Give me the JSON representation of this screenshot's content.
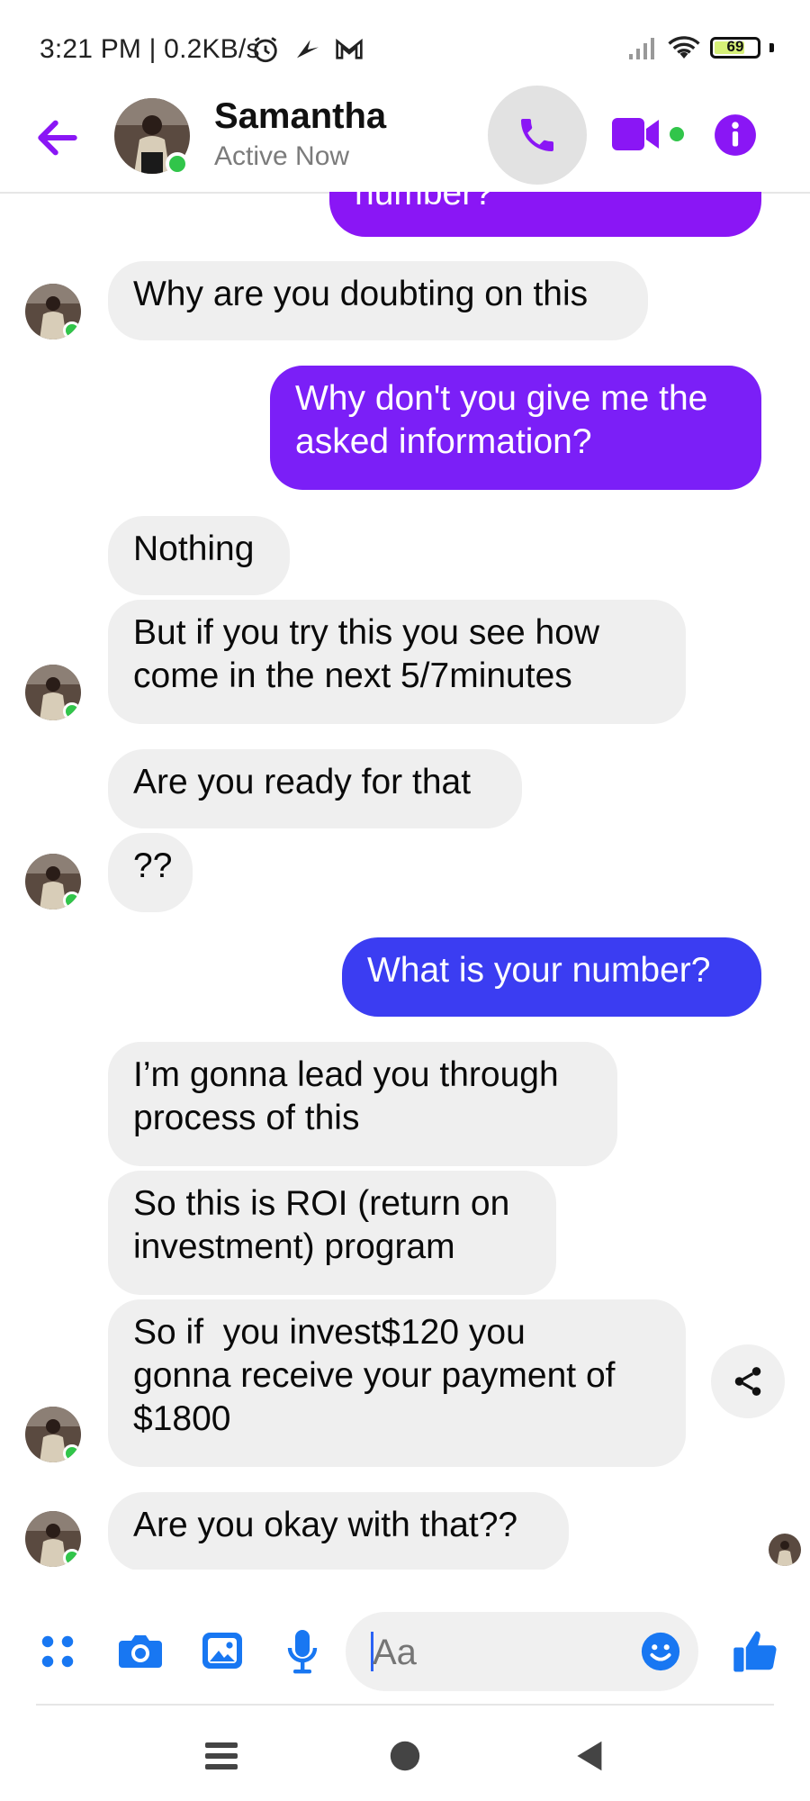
{
  "status_bar": {
    "time_speed": "3:21 PM | 0.2KB/s",
    "battery": "69",
    "battery_level": 0.69,
    "icons": [
      "alarm-icon",
      "bird-icon",
      "gmail-icon",
      "signal-icon",
      "wifi-icon",
      "battery-icon"
    ]
  },
  "header": {
    "name": "Samantha",
    "status": "Active Now",
    "colors": {
      "accent": "#8a16f5",
      "online": "#31c54a"
    }
  },
  "messages": [
    {
      "side": "out",
      "text": "number?"
    },
    {
      "side": "in",
      "text": "Why are you doubting on this"
    },
    {
      "side": "out",
      "text": "Why don't you give me the\nasked information?"
    },
    {
      "side": "in",
      "text": "Nothing"
    },
    {
      "side": "in",
      "text": "But if you try this you see how\ncome in the next 5/7minutes"
    },
    {
      "side": "in",
      "text": "Are you ready for that"
    },
    {
      "side": "in",
      "text": "??"
    },
    {
      "side": "out",
      "text": "What is your number?"
    },
    {
      "side": "in",
      "text": "I’m gonna lead you through\nprocess of this"
    },
    {
      "side": "in",
      "text": "So this is ROI (return on\ninvestment) program"
    },
    {
      "side": "in",
      "text": "So if  you invest$120 you\ngonna receive your payment of\n$1800"
    },
    {
      "side": "in",
      "text": "Are you okay with that??"
    }
  ],
  "composer": {
    "placeholder": "Aa",
    "colors": {
      "icon": "#1877f2"
    }
  }
}
